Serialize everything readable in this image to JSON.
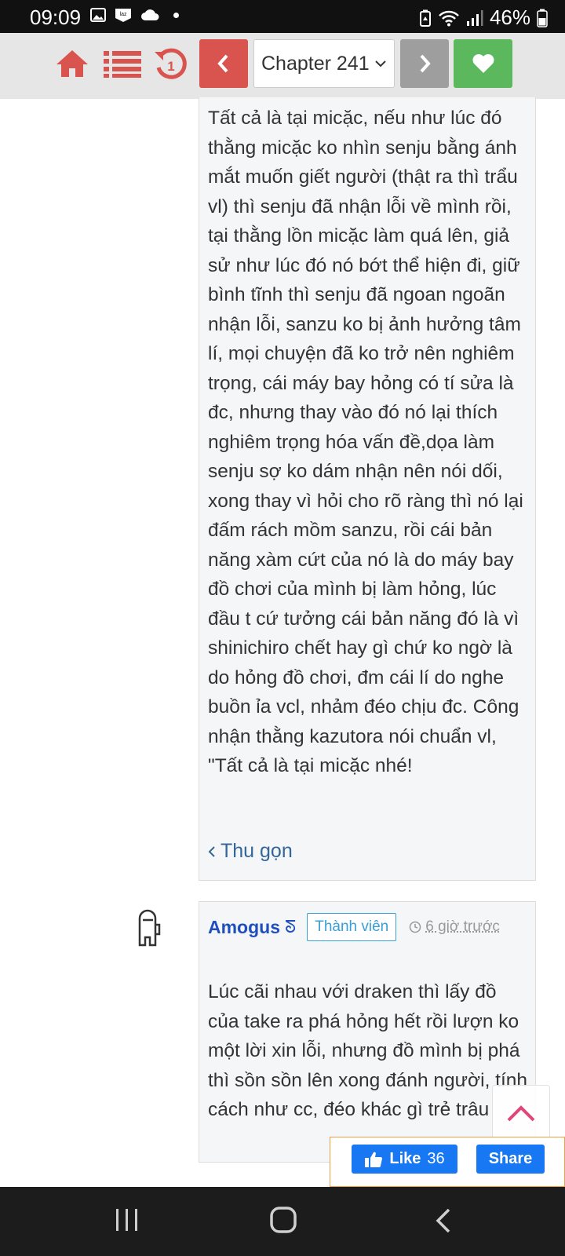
{
  "status_bar": {
    "time": "09:09",
    "battery": "46%"
  },
  "toolbar": {
    "chapter_label": "Chapter 241",
    "colors": {
      "prev": "#d9534f",
      "next": "#9e9e9e",
      "follow": "#5cb85c",
      "icon_red": "#d9534f"
    }
  },
  "comment1": {
    "text": "Tất cả là tại micặc, nếu như lúc đó thằng micặc ko nhìn senju bằng ánh mắt muốn giết người (thật ra thì trẩu vl) thì senju đã nhận lỗi về mình rồi, tại thằng lồn micặc làm quá lên, giả sử như lúc đó nó bớt thể hiện đi, giữ bình tĩnh thì senju đã ngoan ngoãn nhận lỗi, sanzu ko bị ảnh hưởng tâm lí, mọi chuyện đã ko trở nên nghiêm trọng, cái máy bay hỏng có tí sửa là đc, nhưng thay vào đó nó lại thích nghiêm trọng hóa vấn đề,dọa làm senju sợ ko dám nhận nên nói dối, xong thay vì hỏi cho rõ ràng thì nó lại đấm rách mồm sanzu, rồi cái bản năng xàm cứt của nó là do máy bay đồ chơi của mình bị làm hỏng, lúc đầu t cứ tưởng cái bản năng đó là vì shinichiro chết hay gì chứ ko ngờ là do hỏng đồ chơi, đm cái lí do nghe buồn ỉa vcl, nhảm đéo chịu đc. Công nhận thằng kazutora nói chuẩn vl, \"Tất cả là tại micặc nhé!",
    "collapse_label": "Thu gọn"
  },
  "comment2": {
    "username": "Amogus",
    "username_icon": "ᘕ",
    "role": "Thành viên",
    "time": "6 giờ trước",
    "text": "Lúc cãi nhau với draken thì lấy đồ của take ra phá hỏng hết rồi lượn ko một lời xin lỗi, nhưng đồ mình bị phá thì sồn sồn lên xong đánh người, tính cách như cc, đéo khác gì trẻ trâu"
  },
  "facebook": {
    "like_label": "Like",
    "like_count": "36",
    "share_label": "Share"
  }
}
